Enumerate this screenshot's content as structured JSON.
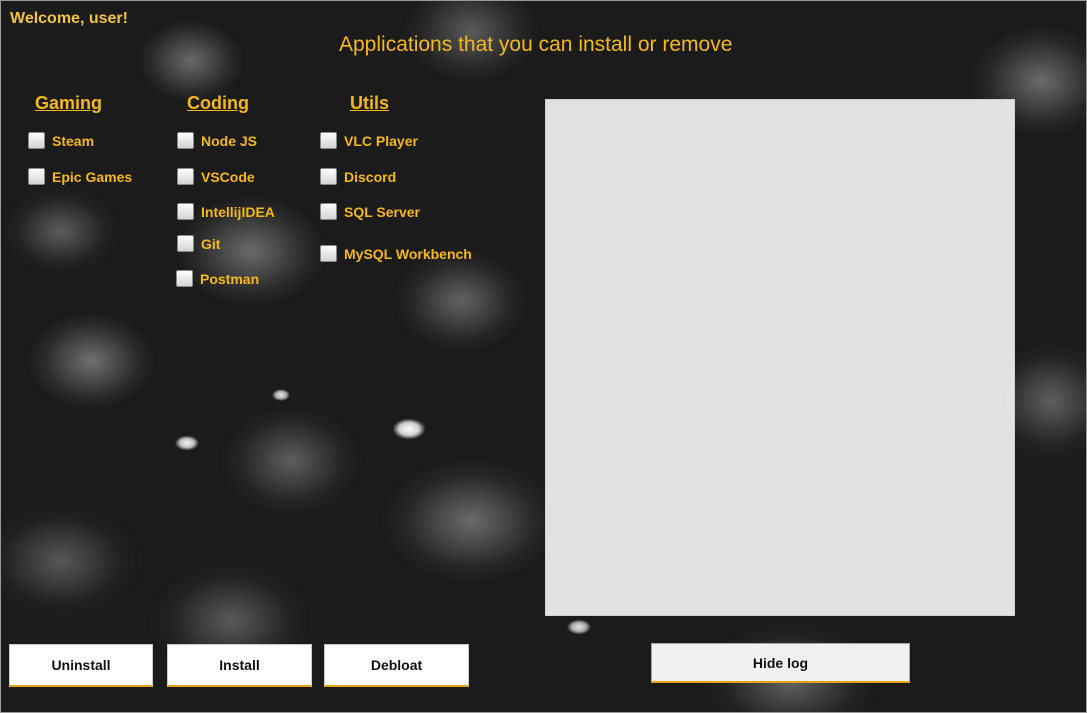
{
  "header": {
    "welcome": "Welcome, user!",
    "title": "Applications that you can install or remove"
  },
  "categories": [
    {
      "heading": "Gaming",
      "items": [
        "Steam",
        "Epic Games"
      ]
    },
    {
      "heading": "Coding",
      "items": [
        "Node JS",
        "VSCode",
        "IntellijIDEA",
        "Git",
        "Postman"
      ]
    },
    {
      "heading": "Utils",
      "items": [
        "VLC Player",
        "Discord",
        "SQL Server",
        "MySQL Workbench"
      ]
    }
  ],
  "checked": {
    "Steam": false,
    "Epic Games": false,
    "Node JS": false,
    "VSCode": false,
    "IntellijIDEA": false,
    "Git": false,
    "Postman": false,
    "VLC Player": false,
    "Discord": false,
    "SQL Server": false,
    "MySQL Workbench": false
  },
  "log": {
    "text": ""
  },
  "buttons": {
    "uninstall": "Uninstall",
    "install": "Install",
    "debloat": "Debloat",
    "hide_log": "Hide log"
  },
  "colors": {
    "accent": "#f6b81a",
    "welcome": "#f3c340",
    "button_border_accent": "#e3a21a",
    "log_background": "#f0f0f0"
  }
}
